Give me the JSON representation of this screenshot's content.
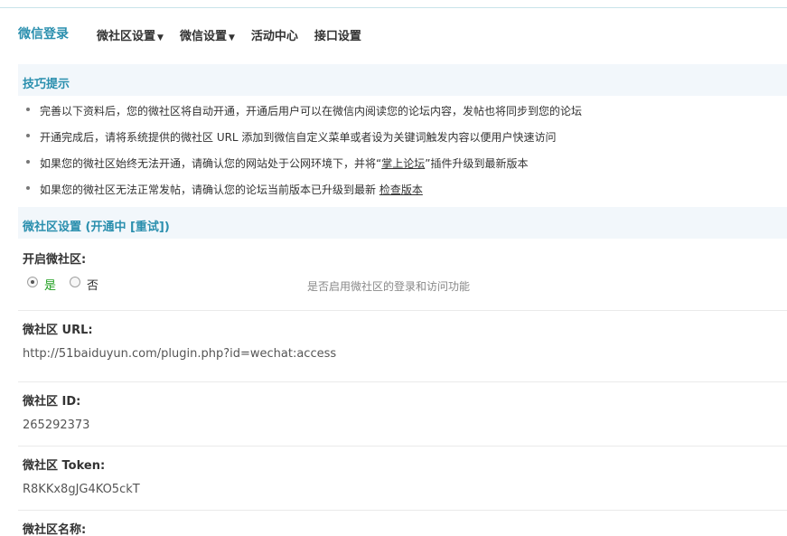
{
  "header": {
    "title": "微信登录",
    "nav": [
      {
        "label": "微社区设置",
        "dropdown": true
      },
      {
        "label": "微信设置",
        "dropdown": true
      },
      {
        "label": "活动中心",
        "dropdown": false
      },
      {
        "label": "接口设置",
        "dropdown": false
      }
    ],
    "caret": "▼"
  },
  "tips": {
    "heading": "技巧提示",
    "items": [
      {
        "text": "完善以下资料后，您的微社区将自动开通，开通后用户可以在微信内阅读您的论坛内容，发帖也将同步到您的论坛"
      },
      {
        "text": "开通完成后，请将系统提供的微社区 URL 添加到微信自定义菜单或者设为关键词触发内容以便用户快速访问"
      },
      {
        "text_before": "如果您的微社区始终无法开通，请确认您的网站处于公网环境下，并将“",
        "link": "掌上论坛",
        "text_after": "”插件升级到最新版本"
      },
      {
        "text_before": "如果您的微社区无法正常发帖，请确认您的论坛当前版本已升级到最新 ",
        "link": "检查版本",
        "text_after": ""
      }
    ]
  },
  "settings": {
    "heading": "微社区设置 (开通中 [重试])",
    "enable": {
      "label": "开启微社区:",
      "options": [
        "是",
        "否"
      ],
      "selected": "是",
      "hint": "是否启用微社区的登录和访问功能"
    },
    "url": {
      "label": "微社区 URL:",
      "value": "http://51baiduyun.com/plugin.php?id=wechat:access"
    },
    "id": {
      "label": "微社区 ID:",
      "value": "265292373"
    },
    "token": {
      "label": "微社区 Token:",
      "value": "R8KKx8gJG4KO5ckT"
    },
    "name": {
      "label": "微社区名称:"
    }
  },
  "colors": {
    "accent": "#2a8fae",
    "section_bg": "#f2f7fb",
    "yes_green": "#1e9e1e"
  }
}
